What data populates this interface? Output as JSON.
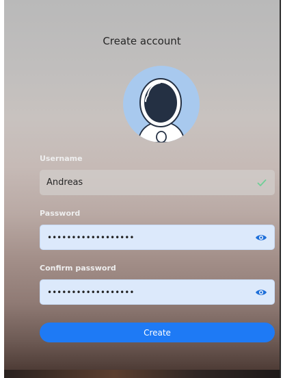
{
  "dialog": {
    "title": "Create account"
  },
  "avatar": {
    "icon": "astronaut-avatar-icon",
    "background_color": "#a8c9ee"
  },
  "form": {
    "username": {
      "label": "Username",
      "value": "Andreas",
      "status_icon": "check-icon",
      "status_color": "#6fcf97"
    },
    "password": {
      "label": "Password",
      "value": "••••••••••••••••••",
      "toggle_icon": "eye-icon"
    },
    "confirm_password": {
      "label": "Confirm password",
      "value": "••••••••••••••••••",
      "toggle_icon": "eye-icon"
    },
    "submit_label": "Create"
  },
  "colors": {
    "accent": "#1e7af5",
    "input_bg": "#dce9fb",
    "eye_icon": "#1e6fd9"
  }
}
